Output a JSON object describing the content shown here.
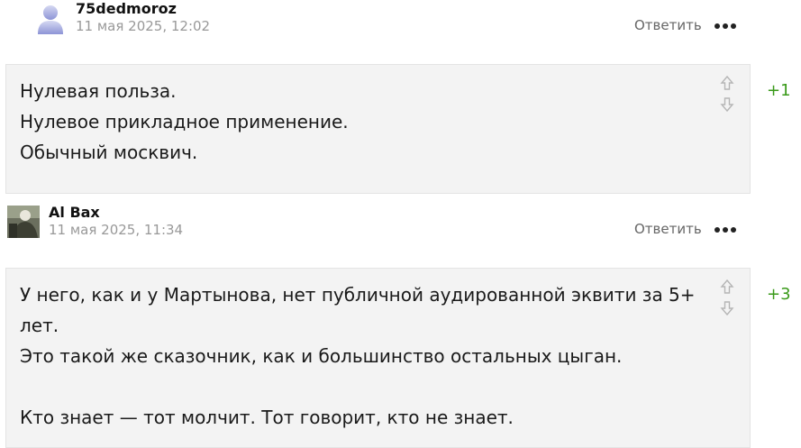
{
  "comments": [
    {
      "author": "75dedmoroz",
      "timestamp": "11 мая 2025, 12:02",
      "reply_label": "Ответить",
      "avatar": "default-user-silhouette",
      "text": "Нулевая польза.\nНулевое прикладное применение.\nОбычный москвич.",
      "rating": "+1"
    },
    {
      "author": "Al Bax",
      "timestamp": "11 мая 2025, 11:34",
      "reply_label": "Ответить",
      "avatar": "user-photo",
      "text": "У него, как и у Мартынова, нет публичной аудированной эквити за 5+ лет.\nЭто такой же сказочник, как и большинство остальных цыган.\n\nКто знает — тот молчит. Тот говорит, кто не знает.",
      "rating": "+3"
    }
  ],
  "colors": {
    "body_bg": "#f3f3f3",
    "rating": "#3a9a1a",
    "timestamp": "#999999"
  }
}
